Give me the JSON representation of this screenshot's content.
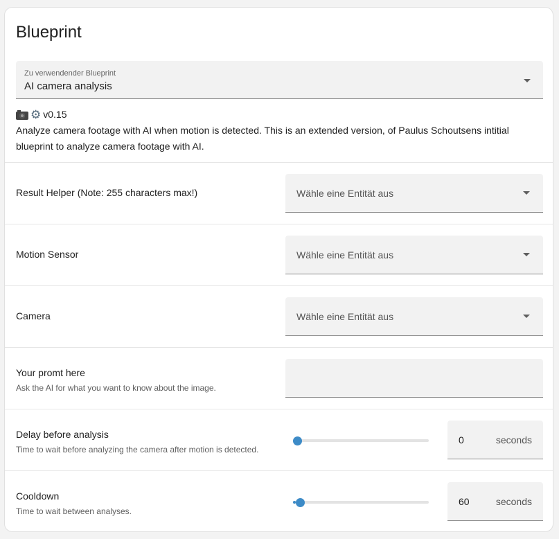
{
  "card": {
    "title": "Blueprint"
  },
  "blueprint_select": {
    "label": "Zu verwendender Blueprint",
    "value": "AI camera analysis"
  },
  "description": {
    "version": "v0.15",
    "text": "Analyze camera footage with AI when motion is detected. This is an extended version, of Paulus Schoutsens intitial blueprint to analyze camera footage with AI.",
    "icons": [
      "camera-icon",
      "gear-icon"
    ]
  },
  "inputs": {
    "result_helper": {
      "label": "Result Helper (Note: 255 characters max!)",
      "placeholder": "Wähle eine Entität aus"
    },
    "motion_sensor": {
      "label": "Motion Sensor",
      "placeholder": "Wähle eine Entität aus"
    },
    "camera": {
      "label": "Camera",
      "placeholder": "Wähle eine Entität aus"
    },
    "prompt": {
      "label": "Your promt here",
      "help": "Ask the AI for what you want to know about the image.",
      "value": ""
    },
    "delay": {
      "label": "Delay before analysis",
      "help": "Time to wait before analyzing the camera after motion is detected.",
      "value": "0",
      "unit": "seconds",
      "slider_fraction": 0.0
    },
    "cooldown": {
      "label": "Cooldown",
      "help": "Time to wait between analyses.",
      "value": "60",
      "unit": "seconds",
      "slider_fraction": 0.02
    }
  },
  "colors": {
    "accent": "#3d8bc7",
    "field_bg": "#f2f2f2"
  }
}
